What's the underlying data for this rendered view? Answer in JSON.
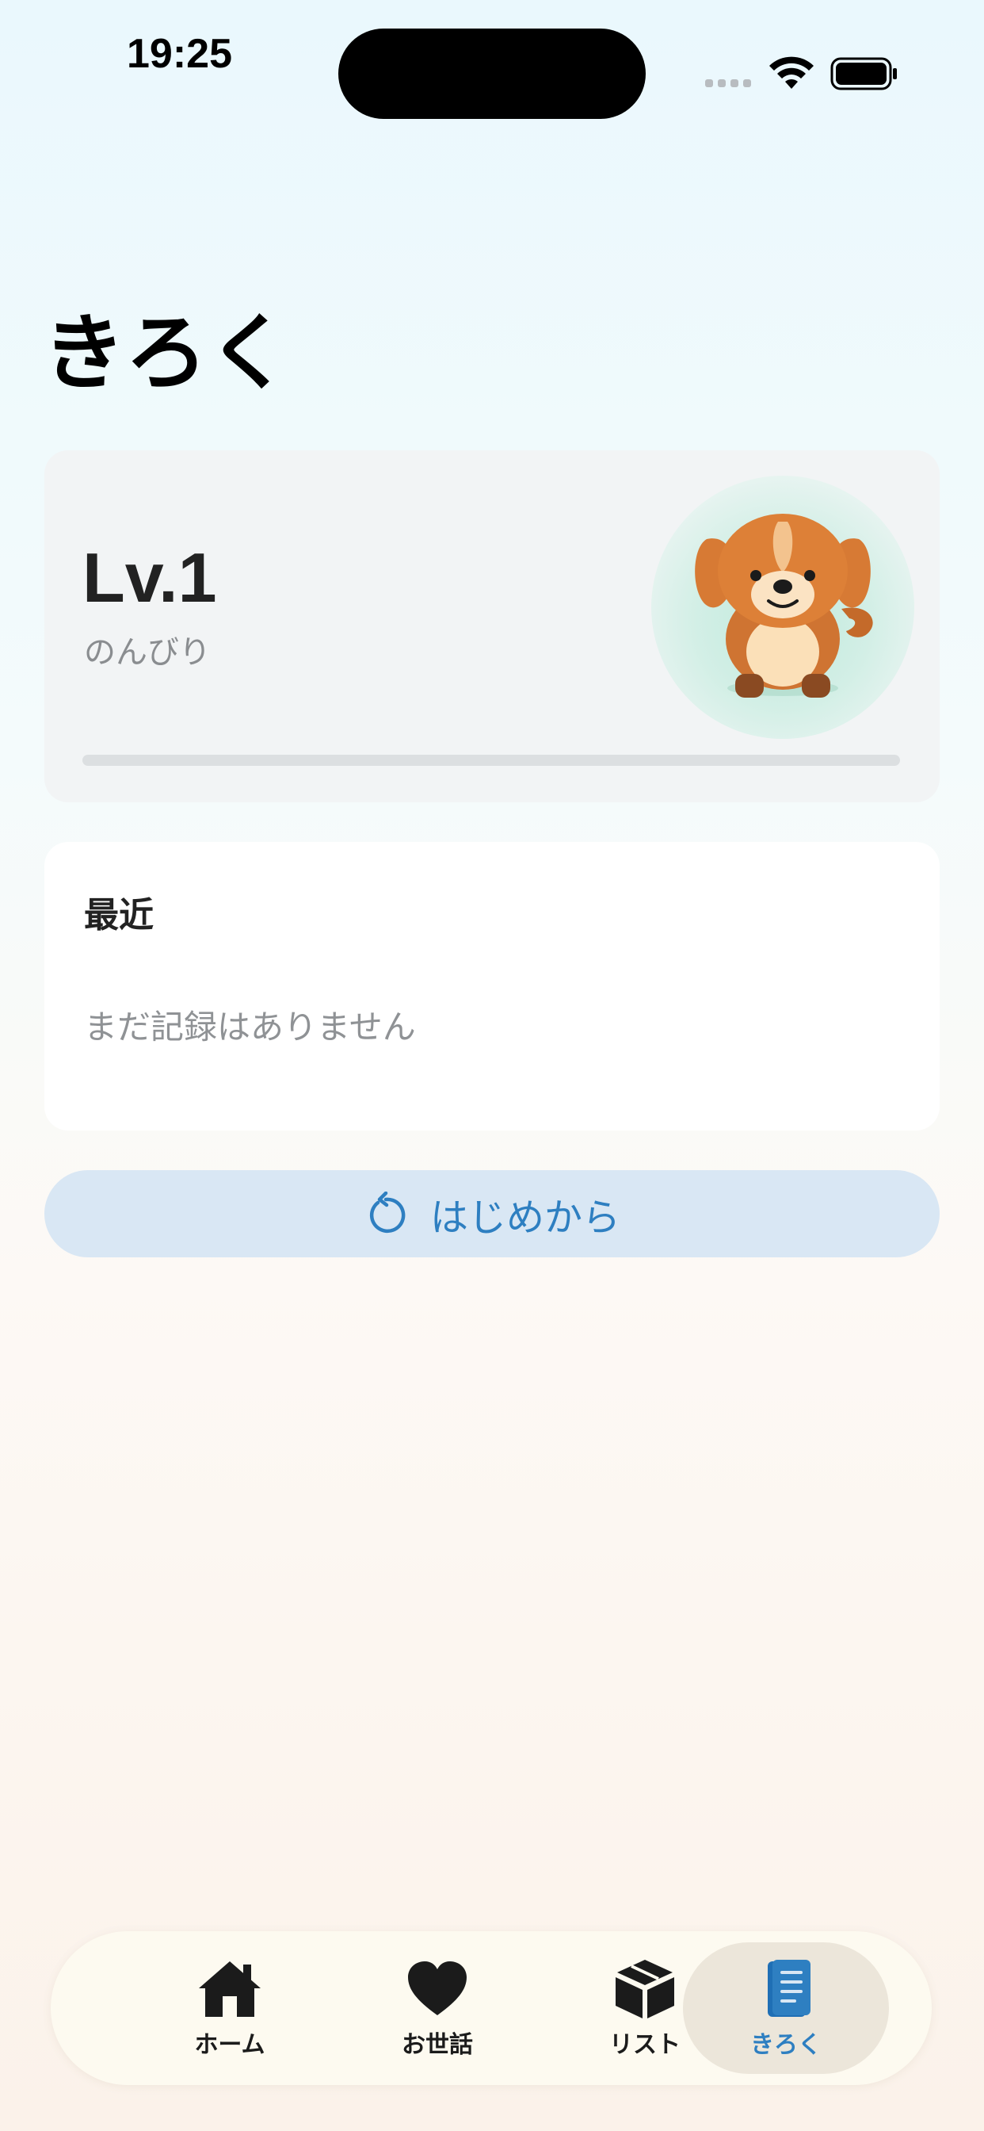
{
  "status_bar": {
    "time": "19:25",
    "icons": [
      "signal-icon",
      "wifi-icon",
      "battery-icon"
    ]
  },
  "header": {
    "title": "きろく"
  },
  "level_card": {
    "level": "Lv.1",
    "mood": "のんびり",
    "pet_image": "dog-pet",
    "experience_progress": 0
  },
  "recent": {
    "title": "最近",
    "empty_message": "まだ記録はありません"
  },
  "restart_button": {
    "icon": "restart-icon",
    "label": "はじめから"
  },
  "tab_bar": {
    "items": [
      {
        "label": "ホーム",
        "icon": "home-icon"
      },
      {
        "label": "お世話",
        "icon": "heart-icon"
      },
      {
        "label": "リスト",
        "icon": "box-icon"
      },
      {
        "label": "きろく",
        "icon": "book-icon"
      }
    ],
    "selected_index": 3
  },
  "colors": {
    "accent": "#2e7fc1",
    "restart_bg": "#d9e7f4",
    "card_bg": "#f2f4f5",
    "tab_bar_bg": "#fdfaf0"
  }
}
